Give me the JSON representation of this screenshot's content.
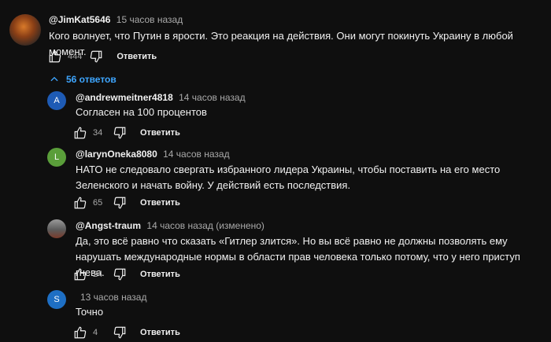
{
  "top_comment": {
    "author": "@JimKat5646",
    "time": "15 часов назад",
    "text": "Кого волнует, что Путин в ярости. Это реакция на действия. Они могут покинуть Украину в любой момент.",
    "likes": "444",
    "reply_label": "Ответить"
  },
  "replies_toggle": {
    "label": "56 ответов",
    "color": "#3ea6ff"
  },
  "replies": [
    {
      "avatar_letter": "A",
      "avatar_color": "#1e5bb5",
      "author": "@andrewmeitner4818",
      "time": "14 часов назад",
      "text": "Согласен на 100 процентов",
      "likes": "34",
      "reply_label": "Ответить"
    },
    {
      "avatar_letter": "L",
      "avatar_color": "#5a9e3a",
      "author": "@larynOneka8080",
      "time": "14 часов назад",
      "text": "НАТО не следовало свергать избранного лидера Украины, чтобы поставить на его место Зеленского и начать войну. У действий есть последствия.",
      "likes": "65",
      "reply_label": "Ответить"
    },
    {
      "avatar_letter": "",
      "avatar_color": "#6b6b6b",
      "author": "@Angst-traum",
      "time": "14 часов назад (изменено)",
      "text": "Да, это всё равно что сказать «Гитлер злится». Но вы всё равно не должны позволять ему нарушать международные нормы в области прав человека только потому, что у него приступ гнева.",
      "likes": "24",
      "reply_label": "Ответить"
    },
    {
      "avatar_letter": "S",
      "avatar_color": "#1e6fc4",
      "author": "",
      "time": "13 часов назад",
      "text": "Точно",
      "likes": "4",
      "reply_label": "Ответить"
    }
  ]
}
